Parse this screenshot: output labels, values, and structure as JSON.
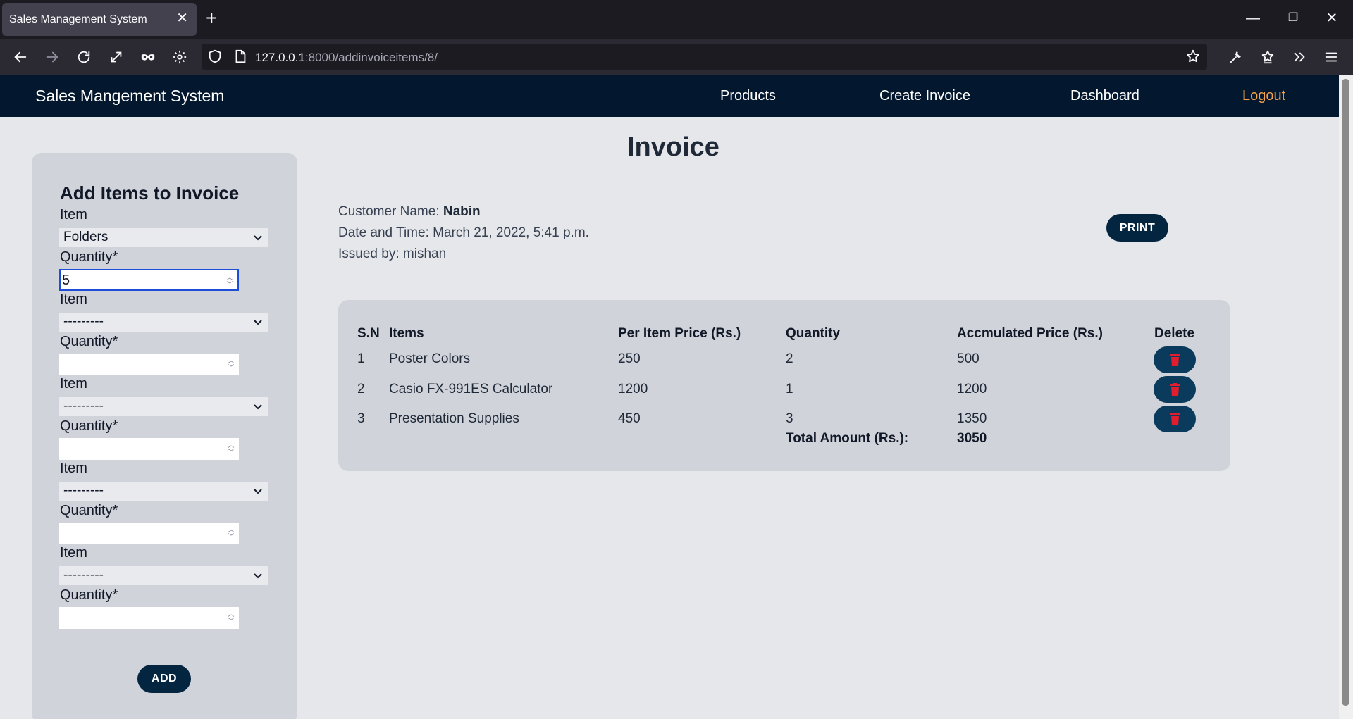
{
  "browser": {
    "tab_title": "Sales Management System",
    "url_host": "127.0.0.1",
    "url_rest": ":8000/addinvoiceitems/8/"
  },
  "header": {
    "brand": "Sales Mangement System",
    "nav": {
      "products": "Products",
      "create_invoice": "Create Invoice",
      "dashboard": "Dashboard",
      "logout": "Logout"
    },
    "logout_color": "#f5a34a",
    "bg_color": "#03182e"
  },
  "form": {
    "title": "Add Items to Invoice",
    "item_label": "Item",
    "quantity_label": "Quantity*",
    "rows": [
      {
        "item": "Folders",
        "quantity": "5"
      },
      {
        "item": "---------",
        "quantity": ""
      },
      {
        "item": "---------",
        "quantity": ""
      },
      {
        "item": "---------",
        "quantity": ""
      },
      {
        "item": "---------",
        "quantity": ""
      }
    ],
    "add_label": "ADD"
  },
  "invoice": {
    "title": "Invoice",
    "customer_label": "Customer Name: ",
    "customer_name": "Nabin",
    "datetime_label": "Date and Time: ",
    "datetime": "March 21, 2022, 5:41 p.m.",
    "issued_label": "Issued by: ",
    "issued_by": "mishan",
    "print_label": "PRINT"
  },
  "table": {
    "headers": {
      "sn": "S.N",
      "items": "Items",
      "per_item": "Per Item Price (Rs.)",
      "quantity": "Quantity",
      "accumulated": "Accmulated Price (Rs.)",
      "delete": "Delete"
    },
    "rows": [
      {
        "sn": "1",
        "item": "Poster Colors",
        "price": "250",
        "qty": "2",
        "total": "500"
      },
      {
        "sn": "2",
        "item": "Casio FX-991ES Calculator",
        "price": "1200",
        "qty": "1",
        "total": "1200"
      },
      {
        "sn": "3",
        "item": "Presentation Supplies",
        "price": "450",
        "qty": "3",
        "total": "1350"
      }
    ],
    "total_label": "Total Amount (Rs.):",
    "total_value": "3050"
  },
  "icons": {
    "back": "back-arrow-icon",
    "forward": "forward-arrow-icon",
    "reload": "reload-icon",
    "delete": "trash-icon"
  },
  "colors": {
    "button": "#03253f",
    "delete_button": "#0b3b5c",
    "trash": "#e11d2e"
  }
}
